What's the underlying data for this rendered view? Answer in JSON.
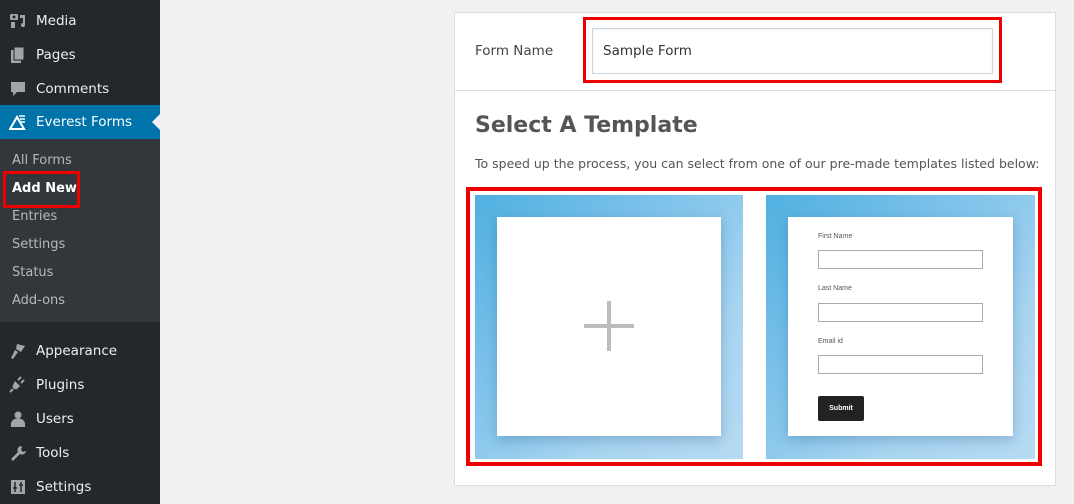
{
  "sidebar": {
    "items": [
      {
        "label": "Media",
        "icon": "media-icon"
      },
      {
        "label": "Pages",
        "icon": "pages-icon"
      },
      {
        "label": "Comments",
        "icon": "comments-icon"
      },
      {
        "label": "Everest Forms",
        "icon": "everest-forms-icon",
        "active": true
      },
      {
        "label": "Appearance",
        "icon": "appearance-icon"
      },
      {
        "label": "Plugins",
        "icon": "plugins-icon"
      },
      {
        "label": "Users",
        "icon": "users-icon"
      },
      {
        "label": "Tools",
        "icon": "tools-icon"
      },
      {
        "label": "Settings",
        "icon": "settings-icon"
      }
    ],
    "submenu": [
      {
        "label": "All Forms"
      },
      {
        "label": "Add New",
        "current": true
      },
      {
        "label": "Entries"
      },
      {
        "label": "Settings"
      },
      {
        "label": "Status"
      },
      {
        "label": "Add-ons"
      }
    ]
  },
  "main": {
    "form_name_label": "Form Name",
    "form_name_value": "Sample Form",
    "title": "Select A Template",
    "description": "To speed up the process, you can select from one of our pre-made templates listed below:",
    "templates": [
      {
        "name": "blank",
        "icon": "plus-icon"
      },
      {
        "name": "contact",
        "fields": [
          "First Name",
          "Last Name",
          "Email id"
        ],
        "submit_label": "Submit"
      }
    ]
  },
  "colors": {
    "sidebar_bg": "#23282d",
    "submenu_bg": "#32373c",
    "active_bg": "#0073aa",
    "highlight": "#ee0000"
  }
}
